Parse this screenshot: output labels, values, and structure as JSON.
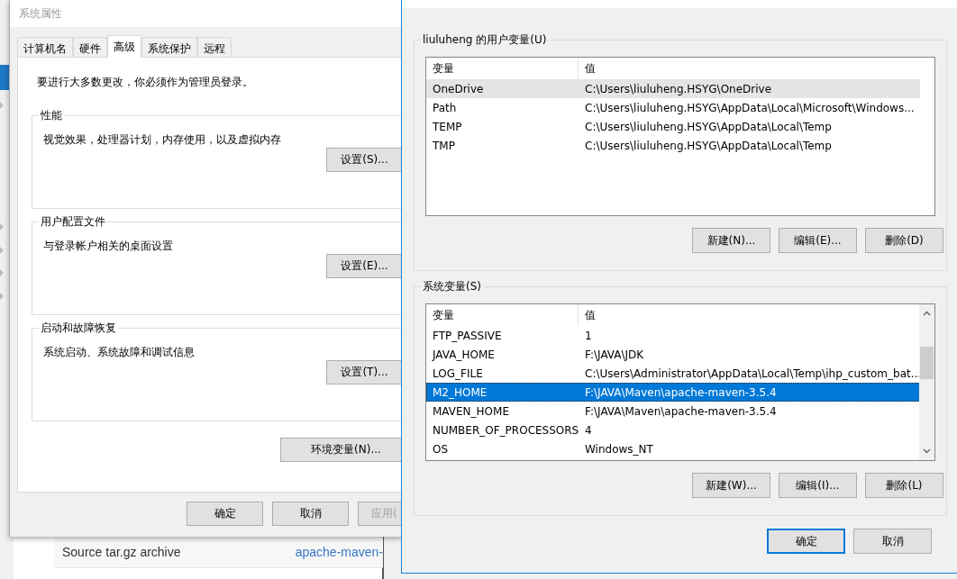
{
  "background_page": {
    "row_label": "Source tar.gz archive",
    "row_link": "apache-maven-"
  },
  "system_properties": {
    "title": "系统属性",
    "tabs": [
      {
        "label": "计算机名",
        "selected": false
      },
      {
        "label": "硬件",
        "selected": false
      },
      {
        "label": "高级",
        "selected": true
      },
      {
        "label": "系统保护",
        "selected": false
      },
      {
        "label": "远程",
        "selected": false
      }
    ],
    "notice": "要进行大多数更改，你必须作为管理员登录。",
    "groups": [
      {
        "title": "性能",
        "description": "视觉效果，处理器计划，内存使用，以及虚拟内存",
        "button": "设置(S)..."
      },
      {
        "title": "用户配置文件",
        "description": "与登录帐户相关的桌面设置",
        "button": "设置(E)..."
      },
      {
        "title": "启动和故障恢复",
        "description": "系统启动、系统故障和调试信息",
        "button": "设置(T)..."
      }
    ],
    "env_button": "环境变量(N)...",
    "buttons": [
      {
        "label": "确定",
        "disabled": false
      },
      {
        "label": "取消",
        "disabled": false
      },
      {
        "label": "应用(",
        "disabled": true
      }
    ]
  },
  "environment_variables": {
    "user_variables": {
      "title": "liuluheng 的用户变量(U)",
      "focused": false,
      "columns": [
        "变量",
        "值"
      ],
      "rows": [
        {
          "name": "OneDrive",
          "value": "C:\\Users\\liuluheng.HSYG\\OneDrive",
          "selected": true
        },
        {
          "name": "Path",
          "value": "C:\\Users\\liuluheng.HSYG\\AppData\\Local\\Microsoft\\Windows...",
          "selected": false
        },
        {
          "name": "TEMP",
          "value": "C:\\Users\\liuluheng.HSYG\\AppData\\Local\\Temp",
          "selected": false
        },
        {
          "name": "TMP",
          "value": "C:\\Users\\liuluheng.HSYG\\AppData\\Local\\Temp",
          "selected": false
        }
      ],
      "buttons": [
        "新建(N)...",
        "编辑(E)...",
        "删除(D)"
      ]
    },
    "system_variables": {
      "title": "系统变量(S)",
      "focused": true,
      "columns": [
        "变量",
        "值"
      ],
      "rows": [
        {
          "name": "FTP_PASSIVE",
          "value": "1",
          "selected": false
        },
        {
          "name": "JAVA_HOME",
          "value": "F:\\JAVA\\JDK",
          "selected": false
        },
        {
          "name": "LOG_FILE",
          "value": "C:\\Users\\Administrator\\AppData\\Local\\Temp\\ihp_custom_bat...",
          "selected": false
        },
        {
          "name": "M2_HOME",
          "value": "F:\\JAVA\\Maven\\apache-maven-3.5.4",
          "selected": true
        },
        {
          "name": "MAVEN_HOME",
          "value": "F:\\JAVA\\Maven\\apache-maven-3.5.4",
          "selected": false
        },
        {
          "name": "NUMBER_OF_PROCESSORS",
          "value": "4",
          "selected": false
        },
        {
          "name": "OS",
          "value": "Windows_NT",
          "selected": false
        }
      ],
      "buttons": [
        "新建(W)...",
        "编辑(I)...",
        "删除(L)"
      ]
    },
    "buttons": [
      {
        "label": "确定",
        "default": true
      },
      {
        "label": "取消",
        "default": false
      }
    ]
  }
}
